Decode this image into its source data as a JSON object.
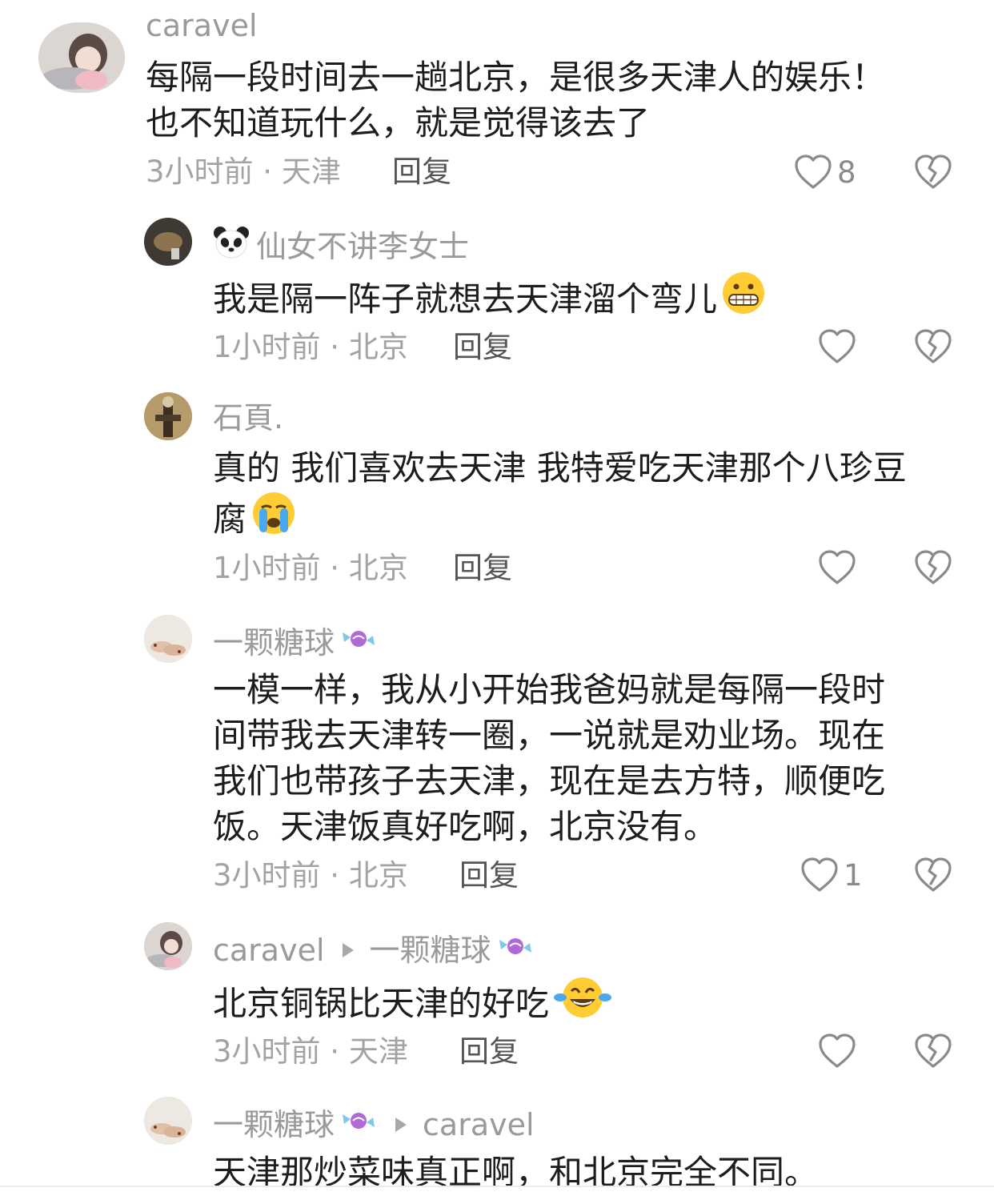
{
  "comments": [
    {
      "name": "caravel",
      "text_lines": [
        "每隔一段时间去一趟北京，是很多天津人的娱乐！",
        "也不知道玩什么，就是觉得该去了"
      ],
      "time_location": "3小时前 · 天津",
      "reply_label": "回复",
      "likes": "8"
    },
    {
      "name": "仙女不讲李女士",
      "name_emoji": "panda-face",
      "text_lines": [
        "我是隔一阵子就想去天津溜个弯儿"
      ],
      "text_emoji": "grimacing-face",
      "time_location": "1小时前 · 北京",
      "reply_label": "回复"
    },
    {
      "name": "石頁.",
      "text_lines": [
        "真的 我们喜欢去天津 我特爱吃天津那个八珍豆",
        "腐"
      ],
      "text_emoji": "loudly-crying-face",
      "time_location": "1小时前 · 北京",
      "reply_label": "回复"
    },
    {
      "name": "一颗糖球",
      "name_emoji": "candy",
      "text_lines": [
        "一模一样，我从小开始我爸妈就是每隔一段时",
        "间带我去天津转一圈，一说就是劝业场。现在",
        "我们也带孩子去天津，现在是去方特，顺便吃",
        "饭。天津饭真好吃啊，北京没有。"
      ],
      "time_location": "3小时前 · 北京",
      "reply_label": "回复",
      "likes": "1"
    },
    {
      "name": "caravel",
      "reply_to": "一颗糖球",
      "reply_to_emoji": "candy",
      "text_lines": [
        "北京铜锅比天津的好吃"
      ],
      "text_emoji": "face-with-tears-of-joy",
      "time_location": "3小时前 · 天津",
      "reply_label": "回复"
    },
    {
      "name": "一颗糖球",
      "name_emoji": "candy",
      "reply_to": "caravel",
      "text_lines": [
        "天津那炒菜味真正啊，和北京完全不同。"
      ]
    }
  ],
  "icons": {
    "like": "heart-outline-icon",
    "dislike": "broken-heart-icon",
    "reply_arrow": "triangle-right-icon"
  },
  "colors": {
    "text": "#1d1d1d",
    "meta": "#a3a3a3",
    "reply": "#555555",
    "icon": "#8a8a8a"
  }
}
